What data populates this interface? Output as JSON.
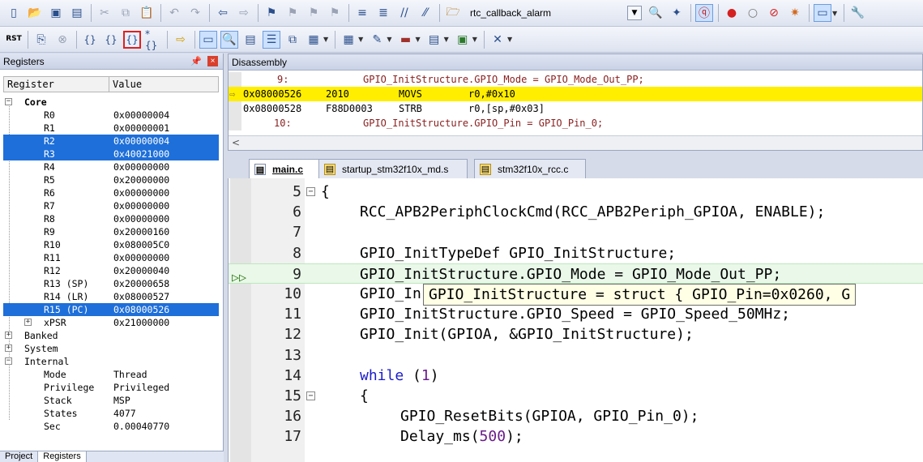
{
  "toolbar1": {
    "target_name": "rtc_callback_alarm"
  },
  "toolbar2": {
    "reset_label": "RST"
  },
  "registers_panel": {
    "title": "Registers",
    "columns": [
      "Register",
      "Value"
    ],
    "core_label": "Core",
    "core": [
      {
        "name": "R0",
        "value": "0x00000004"
      },
      {
        "name": "R1",
        "value": "0x00000001"
      },
      {
        "name": "R2",
        "value": "0x00000004"
      },
      {
        "name": "R3",
        "value": "0x40021000"
      },
      {
        "name": "R4",
        "value": "0x00000000"
      },
      {
        "name": "R5",
        "value": "0x20000000"
      },
      {
        "name": "R6",
        "value": "0x00000000"
      },
      {
        "name": "R7",
        "value": "0x00000000"
      },
      {
        "name": "R8",
        "value": "0x00000000"
      },
      {
        "name": "R9",
        "value": "0x20000160"
      },
      {
        "name": "R10",
        "value": "0x080005C0"
      },
      {
        "name": "R11",
        "value": "0x00000000"
      },
      {
        "name": "R12",
        "value": "0x20000040"
      },
      {
        "name": "R13 (SP)",
        "value": "0x20000658"
      },
      {
        "name": "R14 (LR)",
        "value": "0x08000527"
      },
      {
        "name": "R15 (PC)",
        "value": "0x08000526"
      },
      {
        "name": "xPSR",
        "value": "0x21000000"
      }
    ],
    "groups": [
      "Banked",
      "System",
      "Internal"
    ],
    "internal": [
      {
        "name": "Mode",
        "value": "Thread"
      },
      {
        "name": "Privilege",
        "value": "Privileged"
      },
      {
        "name": "Stack",
        "value": "MSP"
      },
      {
        "name": "States",
        "value": "4077"
      },
      {
        "name": "Sec",
        "value": "0.00040770"
      }
    ],
    "bottom_tabs": [
      "Project",
      "Registers"
    ]
  },
  "disassembly": {
    "title": "Disassembly",
    "lines": [
      {
        "num": "9:",
        "src": "GPIO_InitStructure.GPIO_Mode = GPIO_Mode_Out_PP;"
      },
      {
        "addr": "0x08000526",
        "hex": "2010",
        "op": "MOVS",
        "args": "r0,#0x10"
      },
      {
        "addr": "0x08000528",
        "hex": "F88D0003",
        "op": "STRB",
        "args": "r0,[sp,#0x03]"
      },
      {
        "num": "10:",
        "src": "GPIO_InitStructure.GPIO_Pin = GPIO_Pin_0;"
      }
    ]
  },
  "editor": {
    "tabs": [
      "main.c",
      "startup_stm32f10x_md.s",
      "stm32f10x_rcc.c"
    ],
    "lines": [
      {
        "n": "5",
        "code": "{"
      },
      {
        "n": "6",
        "code": "RCC_APB2PeriphClockCmd(RCC_APB2Periph_GPIOA, ENABLE);"
      },
      {
        "n": "7",
        "code": ""
      },
      {
        "n": "8",
        "code": "GPIO_InitTypeDef GPIO_InitStructure;"
      },
      {
        "n": "9",
        "code": "GPIO_InitStructure.GPIO_Mode = GPIO_Mode_Out_PP;"
      },
      {
        "n": "10",
        "code": "GPIO_In"
      },
      {
        "n": "11",
        "code": "GPIO_InitStructure.GPIO_Speed = GPIO_Speed_50MHz;"
      },
      {
        "n": "12",
        "code": "GPIO_Init(GPIOA, &GPIO_InitStructure);"
      },
      {
        "n": "13",
        "code": ""
      },
      {
        "n": "14",
        "kw": "while",
        "p1": " (",
        "num": "1",
        "p2": ")"
      },
      {
        "n": "15",
        "code": "{"
      },
      {
        "n": "16",
        "code": "GPIO_ResetBits(GPIOA, GPIO_Pin_0);"
      },
      {
        "n": "17",
        "f": "Delay_ms(",
        "num": "500",
        "p2": ");"
      }
    ],
    "tooltip": "GPIO_InitStructure = struct { GPIO_Pin=0x0260, G"
  }
}
